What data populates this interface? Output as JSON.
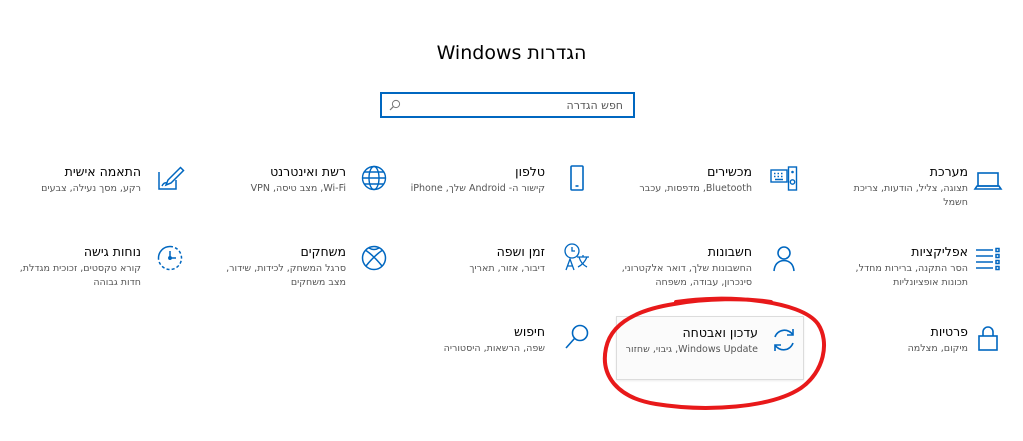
{
  "page": {
    "title": "הגדרות Windows"
  },
  "search": {
    "placeholder": "חפש הגדרה",
    "icon": "search-icon"
  },
  "colors": {
    "accent": "#0067c0",
    "annotation": "#e8191a"
  },
  "tiles": [
    {
      "id": "system",
      "icon": "laptop-icon",
      "title": "מערכת",
      "desc": "תצוגה, צליל, הודעות, צריכת חשמל"
    },
    {
      "id": "devices",
      "icon": "keyboard-icon",
      "title": "מכשירים",
      "desc": "Bluetooth, מדפסות, עכבר"
    },
    {
      "id": "phone",
      "icon": "phone-icon",
      "title": "טלפון",
      "desc": "קישור ה- Android שלך, iPhone"
    },
    {
      "id": "network",
      "icon": "globe-icon",
      "title": "רשת ואינטרנט",
      "desc": "Wi-Fi, מצב טיסה, VPN"
    },
    {
      "id": "personalization",
      "icon": "paintbrush-icon",
      "title": "התאמה אישית",
      "desc": "רקע, מסך נעילה, צבעים"
    },
    {
      "id": "apps",
      "icon": "apps-list-icon",
      "title": "אפליקציות",
      "desc": "הסר התקנה, ברירות מחדל, תכונות אופציונליות"
    },
    {
      "id": "accounts",
      "icon": "person-icon",
      "title": "חשבונות",
      "desc": "החשבונות שלך, דואר אלקטרוני, סינכרון, עבודה, משפחה"
    },
    {
      "id": "time-language",
      "icon": "time-language-icon",
      "title": "זמן ושפה",
      "desc": "דיבור, אזור, תאריך"
    },
    {
      "id": "gaming",
      "icon": "xbox-icon",
      "title": "משחקים",
      "desc": "סרגל המשחק, לכידות, שידור, מצב משחקים"
    },
    {
      "id": "ease-of-access",
      "icon": "ease-of-access-icon",
      "title": "נוחות גישה",
      "desc": "קורא טקסטים, זכוכית מגדלת, חדות גבוהה"
    },
    {
      "id": "privacy",
      "icon": "lock-icon",
      "title": "פרטיות",
      "desc": "מיקום, מצלמה"
    },
    {
      "id": "update-security",
      "icon": "sync-icon",
      "title": "עדכון ואבטחה",
      "desc": "Windows Update, גיבוי, שחזור"
    },
    {
      "id": "search",
      "icon": "magnifier-icon",
      "title": "חיפוש",
      "desc": "שפה, הרשאות, היסטוריה"
    }
  ]
}
